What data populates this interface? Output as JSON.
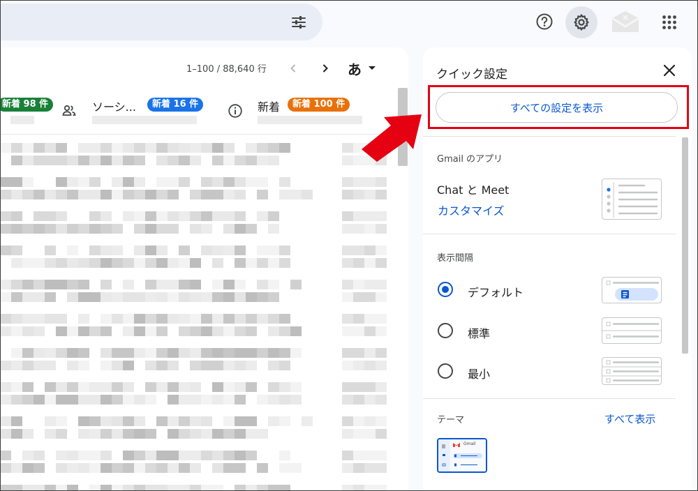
{
  "topbar": {
    "filter_icon": "tune-icon",
    "help_icon": "help-circle-icon",
    "settings_icon": "gear-icon",
    "logo_icon": "envelope-logo-icon",
    "apps_icon": "apps-grid-icon"
  },
  "mail_list": {
    "count_text": "1–100 / 88,640 行",
    "prev_icon": "chevron-left-icon",
    "next_icon": "chevron-right-icon",
    "input_tool_label": "あ",
    "categories": [
      {
        "badge": "新着 98 件",
        "color": "#188038"
      },
      {
        "label": "ソーシ...",
        "badge": "新着 16 件",
        "color": "#1a73e8",
        "icon": "people-icon"
      },
      {
        "label": "新着",
        "badge": "新着 100 件",
        "color": "#e8710a",
        "icon": "info-icon"
      }
    ]
  },
  "quick_settings": {
    "title": "クイック設定",
    "close_icon": "close-icon",
    "all_settings_button": "すべての設定を表示",
    "apps_section": {
      "label": "Gmail のアプリ",
      "item": "Chat と Meet",
      "customize_link": "カスタマイズ"
    },
    "density_section": {
      "label": "表示間隔",
      "options": [
        {
          "label": "デフォルト",
          "checked": true
        },
        {
          "label": "標準",
          "checked": false
        },
        {
          "label": "最小",
          "checked": false
        }
      ]
    },
    "theme_section": {
      "label": "テーマ",
      "view_all_link": "すべて表示",
      "thumbnail_text": "Gmail"
    }
  },
  "colors": {
    "accent": "#0b57d0",
    "highlight": "#e50012",
    "background": "#f8fafd"
  }
}
